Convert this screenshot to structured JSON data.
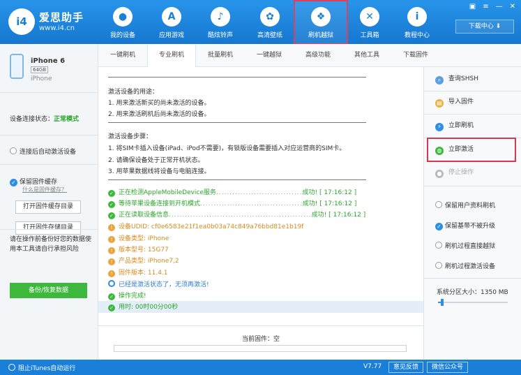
{
  "app": {
    "logo_mark": "i4",
    "name": "爱思助手",
    "url": "www.i4.cn"
  },
  "nav": [
    {
      "label": "我的设备",
      "icon": "apple-icon",
      "glyph": "●"
    },
    {
      "label": "应用游戏",
      "icon": "app-store-icon",
      "glyph": "A"
    },
    {
      "label": "酷炫铃声",
      "icon": "bell-icon",
      "glyph": "♪"
    },
    {
      "label": "高清壁纸",
      "icon": "flower-icon",
      "glyph": "✿"
    },
    {
      "label": "刷机越狱",
      "icon": "dropbox-icon",
      "glyph": "❖"
    },
    {
      "label": "工具箱",
      "icon": "tools-icon",
      "glyph": "✕"
    },
    {
      "label": "教程中心",
      "icon": "info-icon",
      "glyph": "i"
    }
  ],
  "window": {
    "download_center": "下载中心 ⬇"
  },
  "device": {
    "name": "iPhone 6",
    "capacity": "64GB",
    "model": "iPhone",
    "conn_label": "设备连接状态：",
    "conn_status": "正常模式"
  },
  "left": {
    "auto_activate": "连接后自动激活设备",
    "keep_cache": "保留固件缓存",
    "cache_link": "什么是固件缓存？",
    "btn_cache_dir": "打开固件缓存目录",
    "btn_store_dir": "打开固件存储目录",
    "note": "请在操作前备份好您的数据使用本工具请自行承担风险",
    "backup_btn": "备份/恢复数据"
  },
  "tabs": [
    "一键刷机",
    "专业刷机",
    "批量刷机",
    "一键越狱",
    "高级功能",
    "其他工具",
    "下载固件"
  ],
  "content": {
    "purpose_title": "激活设备的用途：",
    "purpose": [
      "1. 用来激活新买的尚未激活的设备。",
      "2. 用来激活刷机后尚未激活的设备。"
    ],
    "steps_title": "激活设备步骤：",
    "steps": [
      "1. 将SIM卡插入设备(iPad、iPod不需要)，有锁版设备需要插入对应运营商的SIM卡。",
      "2. 请确保设备处于正常开机状态。",
      "3. 用苹果数据线将设备与电脑连接。"
    ],
    "logs": [
      {
        "kind": "ok",
        "text": "正在检测AppleMobileDevice服务",
        "dots": "................................",
        "result": "成功! [ 17:16:12 ]"
      },
      {
        "kind": "ok",
        "text": "等待苹果设备连接到开机模式",
        "dots": "......................................",
        "result": "成功! [ 17:16:12 ]"
      },
      {
        "kind": "ok",
        "text": "正在读取设备信息",
        "dots": ".....................................................",
        "result": "成功! [ 17:16:12 ]"
      },
      {
        "kind": "info",
        "text": "设备UDID: cf0e6583e21f1ea0b03a74c849a76bbd81e1b19f"
      },
      {
        "kind": "info",
        "text": "设备类型: iPhone"
      },
      {
        "kind": "info",
        "text": "版本型号: 15G77"
      },
      {
        "kind": "info",
        "text": "产品类型: iPhone7,2"
      },
      {
        "kind": "info",
        "text": "固件版本: 11.4.1"
      },
      {
        "kind": "note",
        "text": "已经是激活状态了，无须再激活!"
      },
      {
        "kind": "ok",
        "text": "操作完成!"
      },
      {
        "kind": "ok",
        "text": "用时: 00时00分00秒"
      }
    ],
    "current_fw": "当前固件：空"
  },
  "right": {
    "actions": [
      {
        "label": "查询SHSH",
        "icon": "search-icon",
        "glyph": "⌕",
        "color": "#5aa0e0"
      },
      {
        "label": "导入固件",
        "icon": "folder-icon",
        "glyph": "▤",
        "color": "#e9b23c"
      },
      {
        "label": "立即刷机",
        "icon": "lightning-icon",
        "glyph": "⚡",
        "color": "#2d8ee4"
      },
      {
        "label": "立即激活",
        "icon": "globe-icon",
        "glyph": "◍",
        "color": "#3db83d"
      },
      {
        "label": "停止操作",
        "icon": "stop-icon",
        "glyph": "●",
        "color": "#bbbbbb"
      }
    ],
    "options": [
      "保留用户资料刷机",
      "保留基带不被升级",
      "刷机过程直接越狱",
      "刷机过程激活设备"
    ],
    "options_checked": [
      false,
      true,
      false,
      false
    ],
    "partition_label": "系统分区大小：",
    "partition_value": "1350 MB"
  },
  "status": {
    "block_itunes": "阻止iTunes自动运行",
    "version": "V7.77",
    "feedback": "意见反馈",
    "wechat": "微信公众号"
  }
}
